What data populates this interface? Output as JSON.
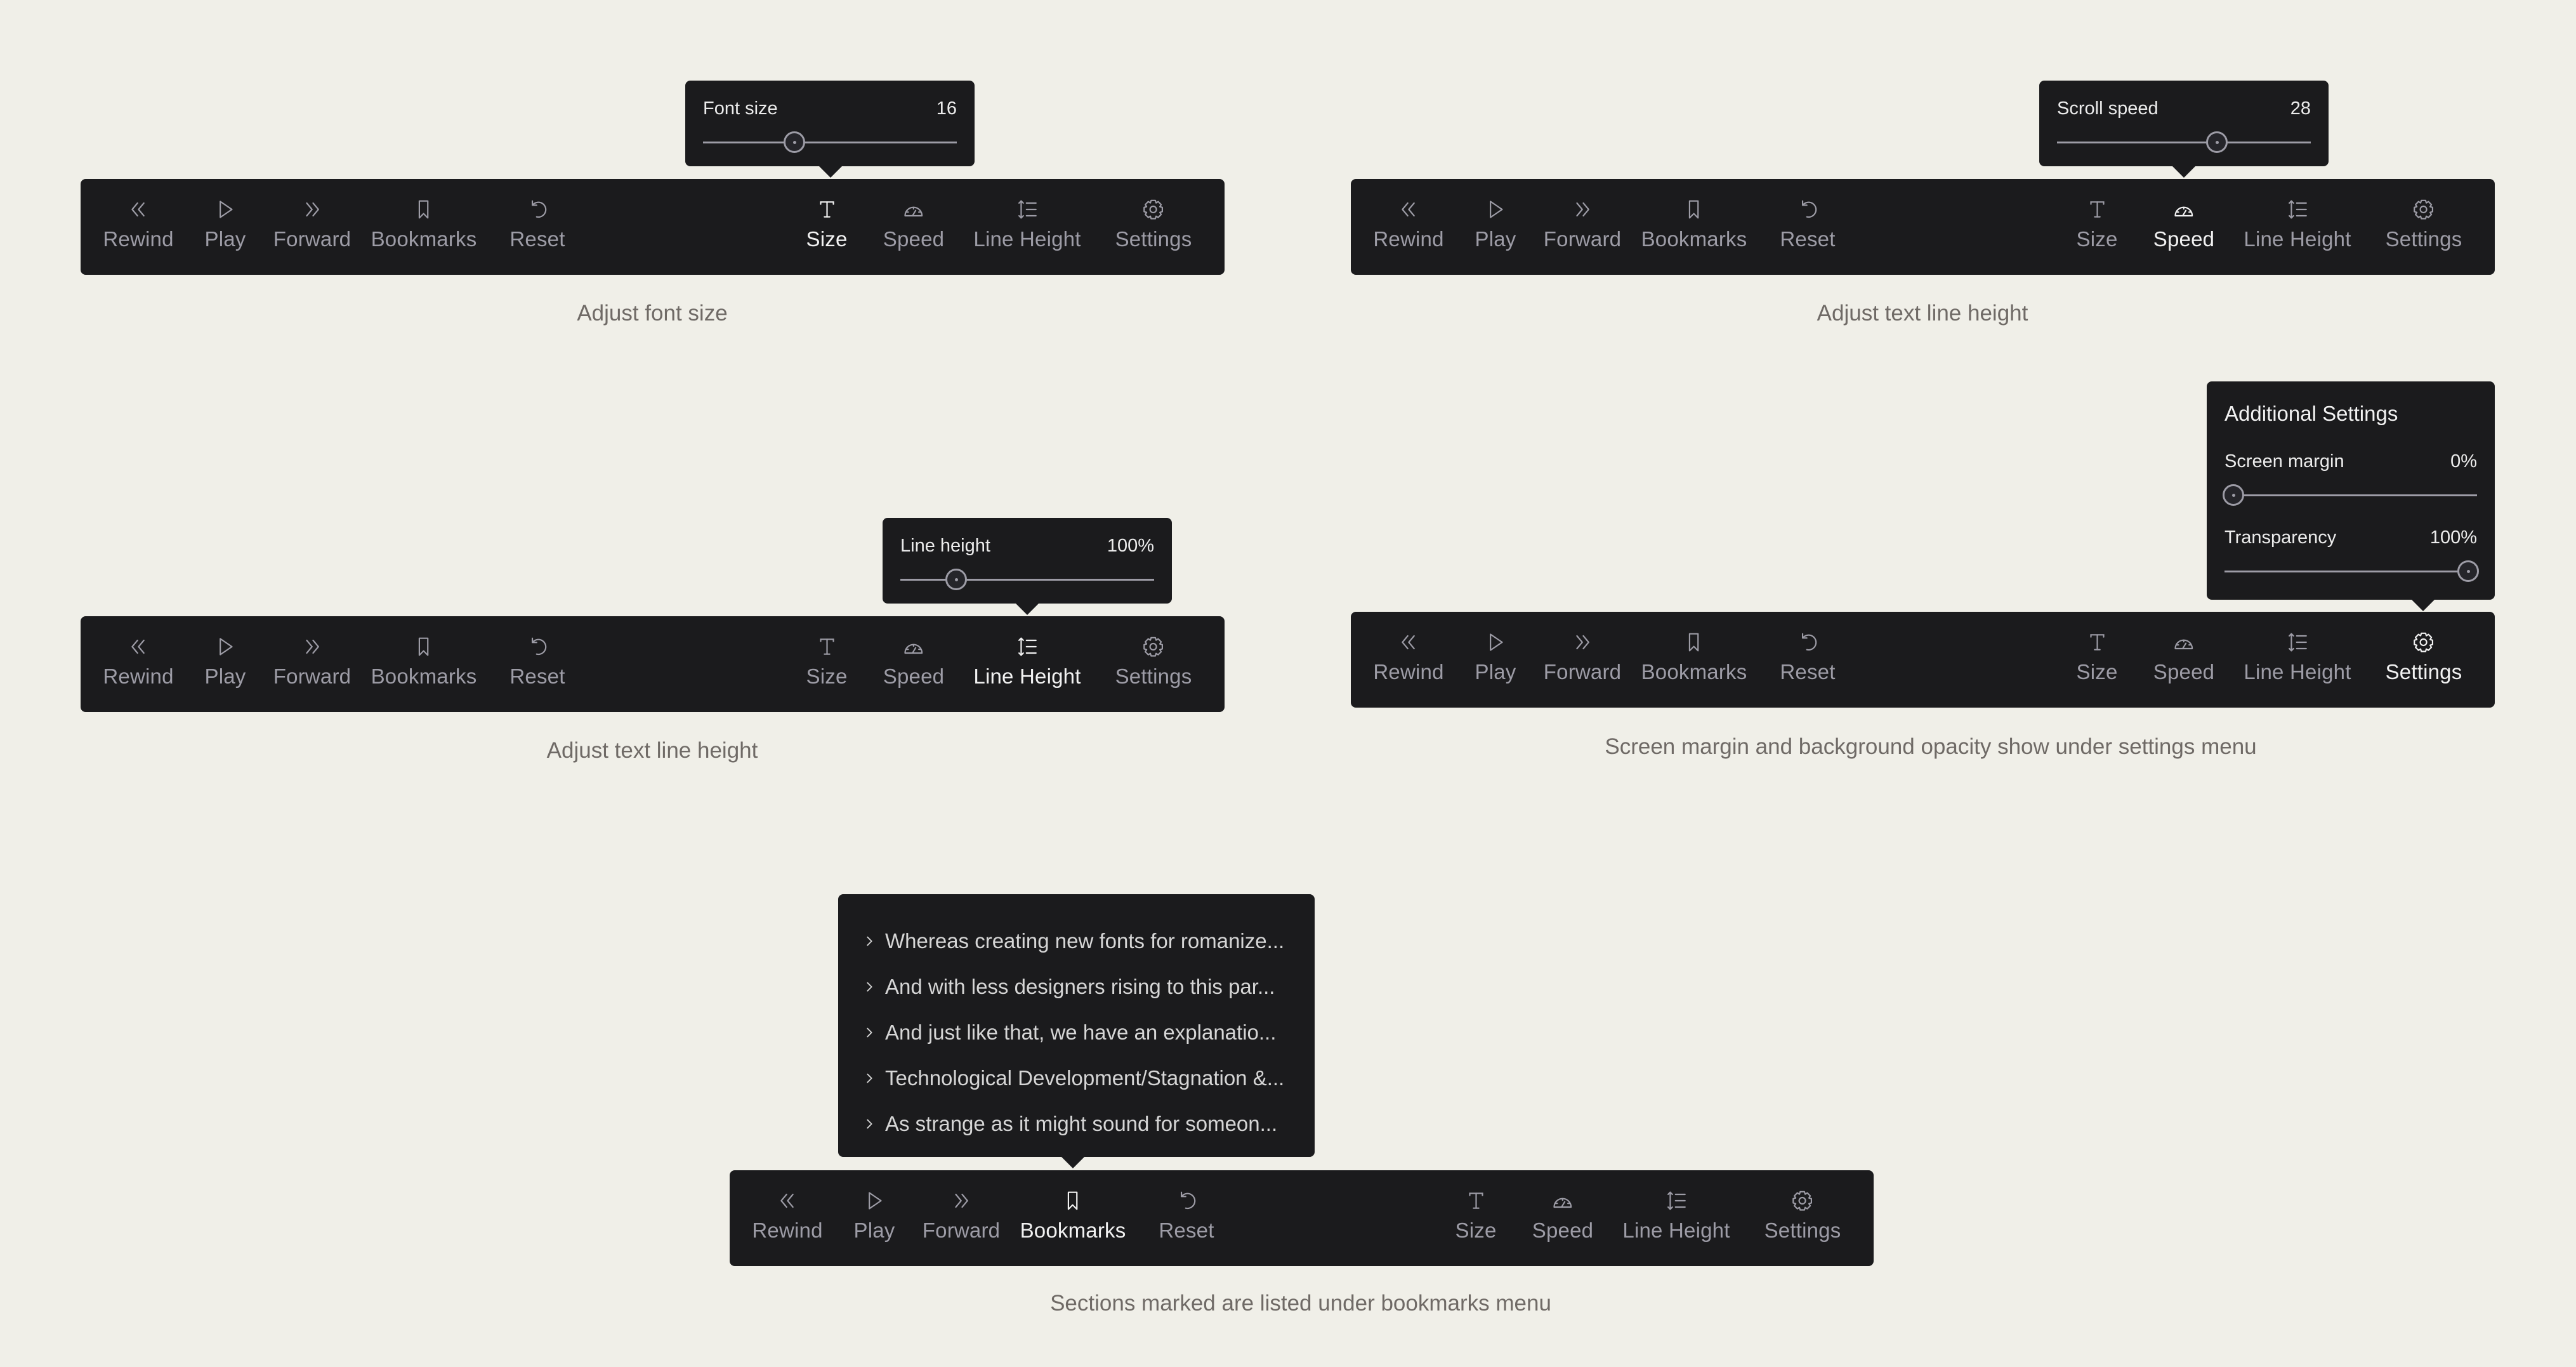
{
  "colors": {
    "background": "#f0efe8",
    "toolbar": "#1b1b1d",
    "inactive_text": "#9d9ca6",
    "active_text": "#f2f2f2",
    "caption_text": "#6f6a66"
  },
  "toolbar_items": [
    {
      "id": "rewind",
      "label": "Rewind",
      "icon": "rewind-icon"
    },
    {
      "id": "play",
      "label": "Play",
      "icon": "play-icon"
    },
    {
      "id": "forward",
      "label": "Forward",
      "icon": "forward-icon"
    },
    {
      "id": "bookmarks",
      "label": "Bookmarks",
      "icon": "bookmark-icon"
    },
    {
      "id": "reset",
      "label": "Reset",
      "icon": "reset-icon"
    },
    {
      "id": "size",
      "label": "Size",
      "icon": "text-size-icon"
    },
    {
      "id": "speed",
      "label": "Speed",
      "icon": "speedometer-icon"
    },
    {
      "id": "line-height",
      "label": "Line Height",
      "icon": "line-height-icon"
    },
    {
      "id": "settings",
      "label": "Settings",
      "icon": "gear-icon"
    }
  ],
  "panels": {
    "size": {
      "active": "size",
      "caption": "Adjust font size",
      "popover": {
        "label": "Font size",
        "value": "16",
        "slider_fraction": 0.35
      }
    },
    "speed": {
      "active": "speed",
      "caption": "Adjust text line height",
      "popover": {
        "label": "Scroll speed",
        "value": "28",
        "slider_fraction": 0.64
      }
    },
    "line_height": {
      "active": "line-height",
      "caption": "Adjust text line height",
      "popover": {
        "label": "Line height",
        "value": "100%",
        "slider_fraction": 0.2
      }
    },
    "settings": {
      "active": "settings",
      "caption": "Screen margin and background opacity show under settings menu",
      "popover": {
        "title": "Additional Settings",
        "rows": [
          {
            "label": "Screen margin",
            "value": "0%",
            "slider_fraction": 0.0
          },
          {
            "label": "Transparency",
            "value": "100%",
            "slider_fraction": 1.0
          }
        ]
      }
    },
    "bookmarks": {
      "active": "bookmarks",
      "caption": "Sections marked are listed under bookmarks menu",
      "items": [
        "Whereas creating new fonts for romanize...",
        "And with less designers rising to this par...",
        "And just like that, we have an explanatio...",
        "Technological Development/Stagnation &...",
        "As strange as it might sound for someon..."
      ]
    }
  }
}
